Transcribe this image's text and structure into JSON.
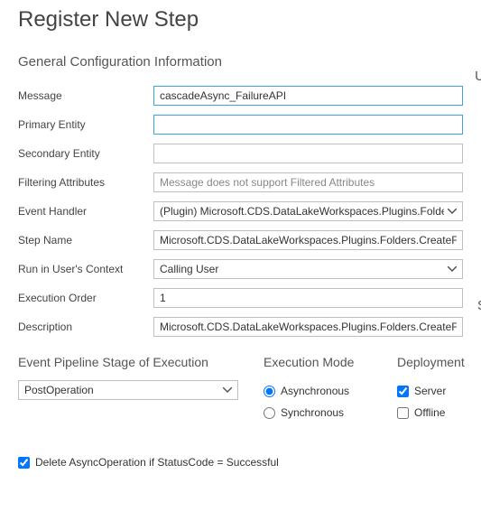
{
  "title": "Register New Step",
  "sections": {
    "general": "General Configuration Information",
    "pipeline": "Event Pipeline Stage of Execution",
    "mode": "Execution Mode",
    "deploy": "Deployment",
    "right_cut_1": "U",
    "right_cut_2": "S"
  },
  "labels": {
    "message": "Message",
    "primaryEntity": "Primary Entity",
    "secondaryEntity": "Secondary Entity",
    "filteringAttributes": "Filtering Attributes",
    "eventHandler": "Event Handler",
    "stepName": "Step Name",
    "runContext": "Run in User's Context",
    "execOrder": "Execution Order",
    "description": "Description"
  },
  "values": {
    "message": "cascadeAsync_FailureAPI",
    "primaryEntity": "",
    "secondaryEntity": "",
    "filteringAttributes": "",
    "filteringPlaceholder": "Message does not support Filtered Attributes",
    "eventHandler": "(Plugin) Microsoft.CDS.DataLakeWorkspaces.Plugins.Folders.C",
    "stepName": "Microsoft.CDS.DataLakeWorkspaces.Plugins.Folders.CreateFolderA",
    "runContext": "Calling User",
    "execOrder": "1",
    "description": "Microsoft.CDS.DataLakeWorkspaces.Plugins.Folders.CreateFolderA",
    "pipelineStage": "PostOperation"
  },
  "mode": {
    "async": "Asynchronous",
    "sync": "Synchronous",
    "selected": "async"
  },
  "deploy": {
    "server": "Server",
    "offline": "Offline",
    "serverChecked": true,
    "offlineChecked": false
  },
  "footer": {
    "deleteAsync": "Delete AsyncOperation if StatusCode = Successful",
    "checked": true
  }
}
